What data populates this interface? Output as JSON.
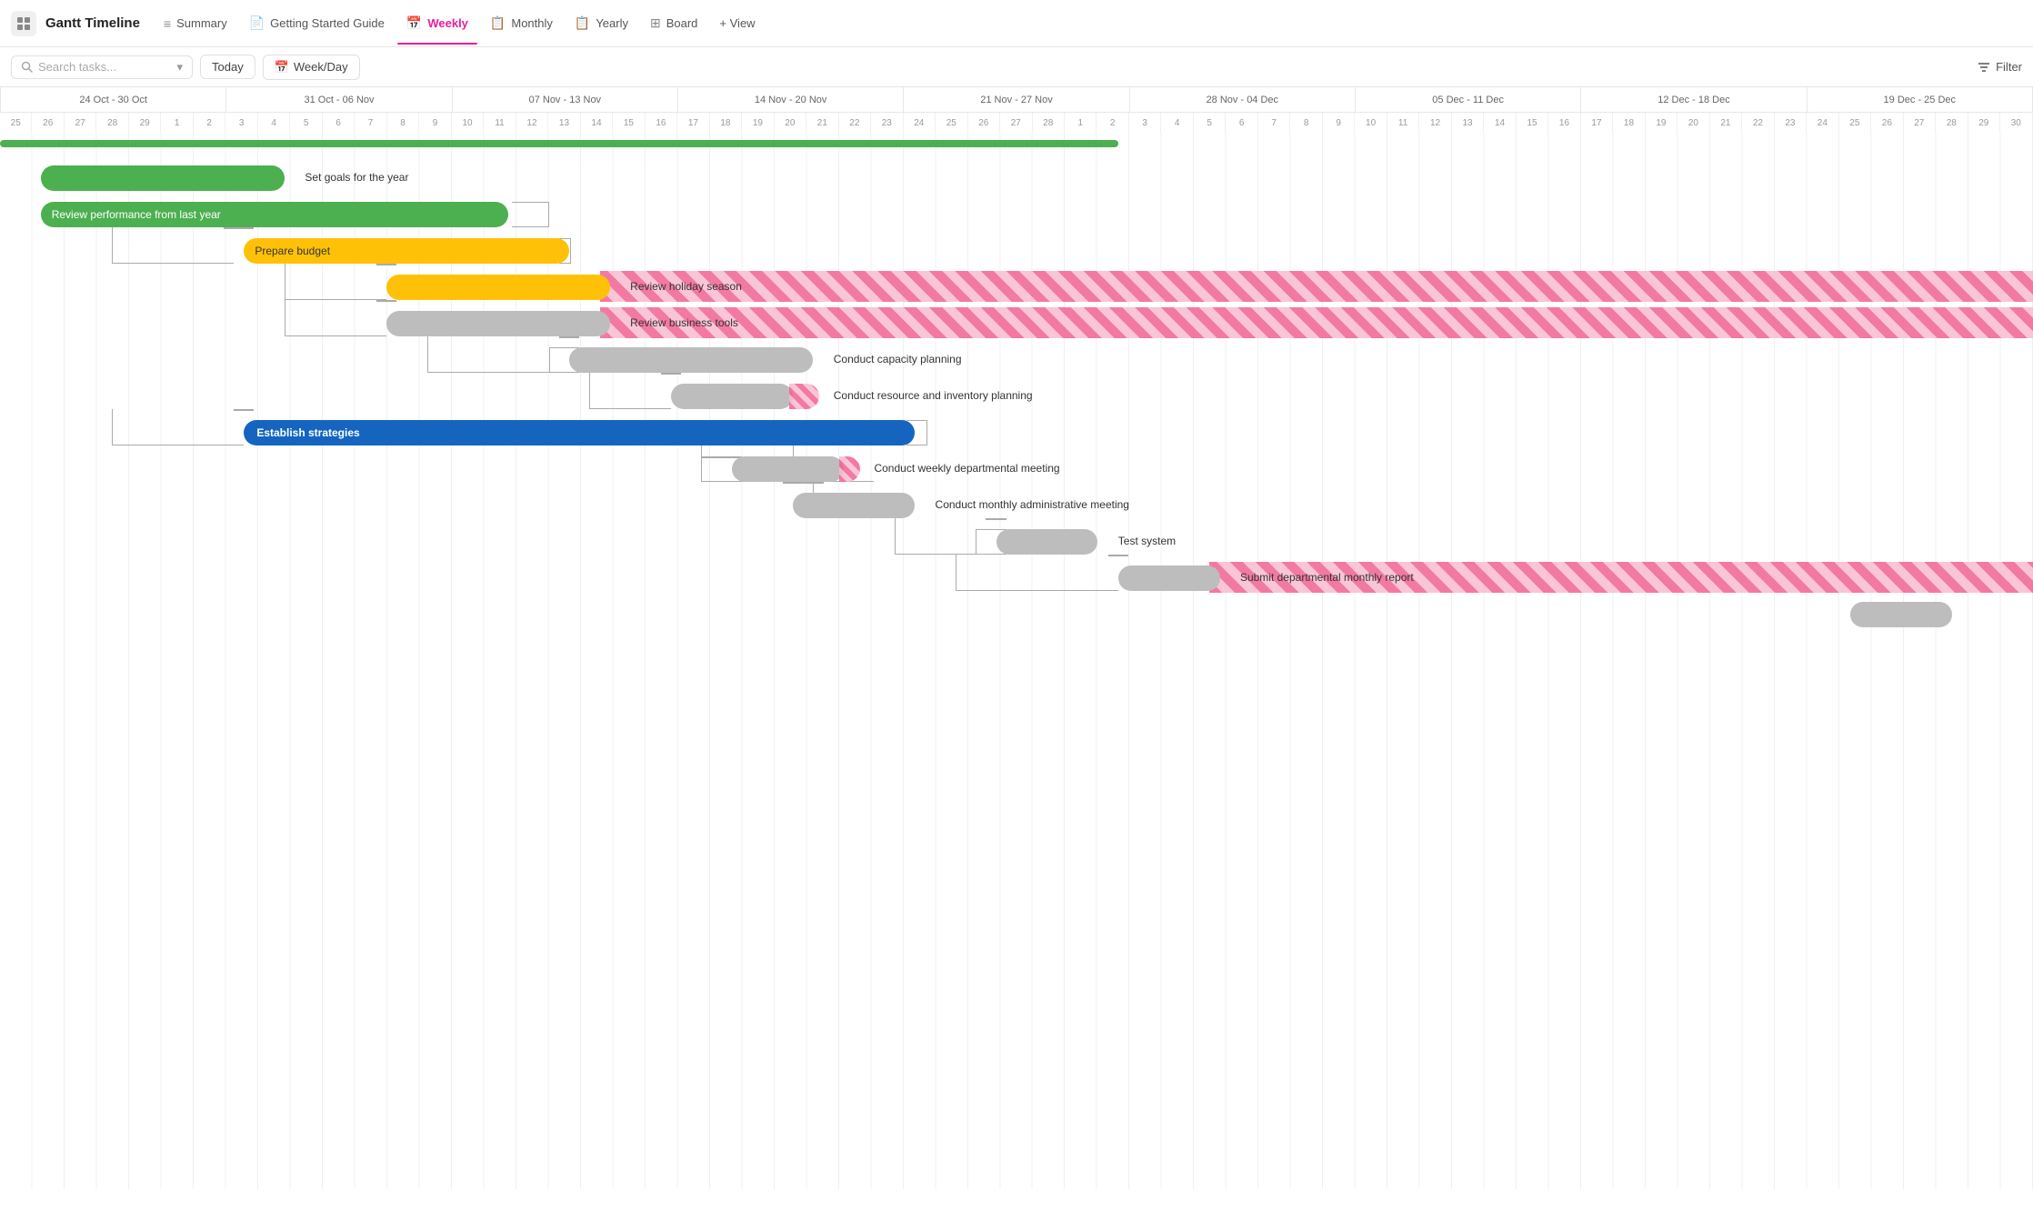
{
  "app": {
    "icon": "⊞",
    "title": "Gantt Timeline"
  },
  "nav": {
    "tabs": [
      {
        "id": "summary",
        "label": "Summary",
        "icon": "≡",
        "active": false
      },
      {
        "id": "getting-started",
        "label": "Getting Started Guide",
        "icon": "📄",
        "active": false
      },
      {
        "id": "weekly",
        "label": "Weekly",
        "icon": "📅",
        "active": true
      },
      {
        "id": "monthly",
        "label": "Monthly",
        "icon": "📋",
        "active": false
      },
      {
        "id": "yearly",
        "label": "Yearly",
        "icon": "📋",
        "active": false
      },
      {
        "id": "board",
        "label": "Board",
        "icon": "⊞",
        "active": false
      }
    ],
    "add_view_label": "+ View"
  },
  "toolbar": {
    "search_placeholder": "Search tasks...",
    "today_label": "Today",
    "weekday_label": "Week/Day",
    "filter_label": "Filter"
  },
  "timeline": {
    "weeks": [
      {
        "label": "24 Oct - 30 Oct"
      },
      {
        "label": "31 Oct - 06 Nov"
      },
      {
        "label": "07 Nov - 13 Nov"
      },
      {
        "label": "14 Nov - 20 Nov"
      },
      {
        "label": "21 Nov - 27 Nov"
      },
      {
        "label": "28 Nov - 04 Dec"
      },
      {
        "label": "05 Dec - 11 Dec"
      },
      {
        "label": "12 Dec - 18 Dec"
      },
      {
        "label": "19 Dec - 25 Dec"
      }
    ],
    "days": [
      "25",
      "26",
      "27",
      "28",
      "29",
      "1",
      "2",
      "3",
      "4",
      "5",
      "6",
      "7",
      "8",
      "9",
      "10",
      "11",
      "12",
      "13",
      "14",
      "15",
      "16",
      "17",
      "18",
      "19",
      "20",
      "21",
      "22",
      "23",
      "24",
      "25",
      "26",
      "27",
      "28",
      "1",
      "2",
      "3",
      "4",
      "5",
      "6",
      "7",
      "8",
      "9",
      "10",
      "11",
      "12",
      "13",
      "14",
      "15",
      "16",
      "17",
      "18",
      "19",
      "20",
      "21",
      "22",
      "23",
      "24",
      "25",
      "26",
      "27",
      "28",
      "29",
      "30"
    ]
  },
  "tasks": [
    {
      "id": 1,
      "label": "Set goals for the year",
      "color": "green",
      "indent": 0,
      "bar_left_pct": 2,
      "bar_width_pct": 12,
      "label_outside": true,
      "label_outside_left_pct": 15
    },
    {
      "id": 2,
      "label": "Review performance from last year",
      "color": "green",
      "indent": 0,
      "bar_left_pct": 2,
      "bar_width_pct": 22,
      "label_outside": false
    },
    {
      "id": 3,
      "label": "Prepare budget",
      "color": "yellow",
      "indent": 1,
      "bar_left_pct": 11,
      "bar_width_pct": 16,
      "label_outside": false
    },
    {
      "id": 4,
      "label": "Review holiday season",
      "color": "yellow",
      "stripe": false,
      "indent": 2,
      "bar_left_pct": 18,
      "bar_width_pct": 11,
      "label_outside": true,
      "label_outside_left_pct": 30,
      "stripe_right": true
    },
    {
      "id": 5,
      "label": "Review business tools",
      "color": "gray",
      "indent": 2,
      "bar_left_pct": 18,
      "bar_width_pct": 11,
      "label_outside": true,
      "label_outside_left_pct": 30,
      "stripe_right": true
    },
    {
      "id": 6,
      "label": "Conduct capacity planning",
      "color": "gray",
      "indent": 3,
      "bar_left_pct": 27,
      "bar_width_pct": 12,
      "label_outside": true,
      "label_outside_left_pct": 40
    },
    {
      "id": 7,
      "label": "Conduct resource and inventory planning",
      "color": "gray",
      "indent": 3,
      "bar_left_pct": 32,
      "bar_width_pct": 6,
      "label_outside": true,
      "label_outside_left_pct": 39,
      "stripe_partial": true
    },
    {
      "id": 8,
      "label": "Establish strategies",
      "color": "blue",
      "indent": 1,
      "bar_left_pct": 11,
      "bar_width_pct": 33,
      "label_outside": false
    },
    {
      "id": 9,
      "label": "Conduct weekly departmental meeting",
      "color": "gray",
      "indent": 2,
      "bar_left_pct": 35,
      "bar_width_pct": 6,
      "label_outside": true,
      "label_outside_left_pct": 42,
      "stripe_partial": true
    },
    {
      "id": 10,
      "label": "Conduct monthly administrative meeting",
      "color": "gray",
      "indent": 2,
      "bar_left_pct": 38,
      "bar_width_pct": 6,
      "label_outside": true,
      "label_outside_left_pct": 45
    },
    {
      "id": 11,
      "label": "Test system",
      "color": "gray",
      "indent": 3,
      "bar_left_pct": 48,
      "bar_width_pct": 5,
      "label_outside": true,
      "label_outside_left_pct": 54
    },
    {
      "id": 12,
      "label": "Submit departmental monthly report",
      "color": "gray",
      "indent": 3,
      "bar_left_pct": 54,
      "bar_width_pct": 5,
      "label_outside": true,
      "label_outside_left_pct": 60,
      "stripe_right": true
    },
    {
      "id": 13,
      "label": "",
      "color": "gray",
      "indent": 4,
      "bar_left_pct": 91,
      "bar_width_pct": 5,
      "label_outside": false
    }
  ]
}
